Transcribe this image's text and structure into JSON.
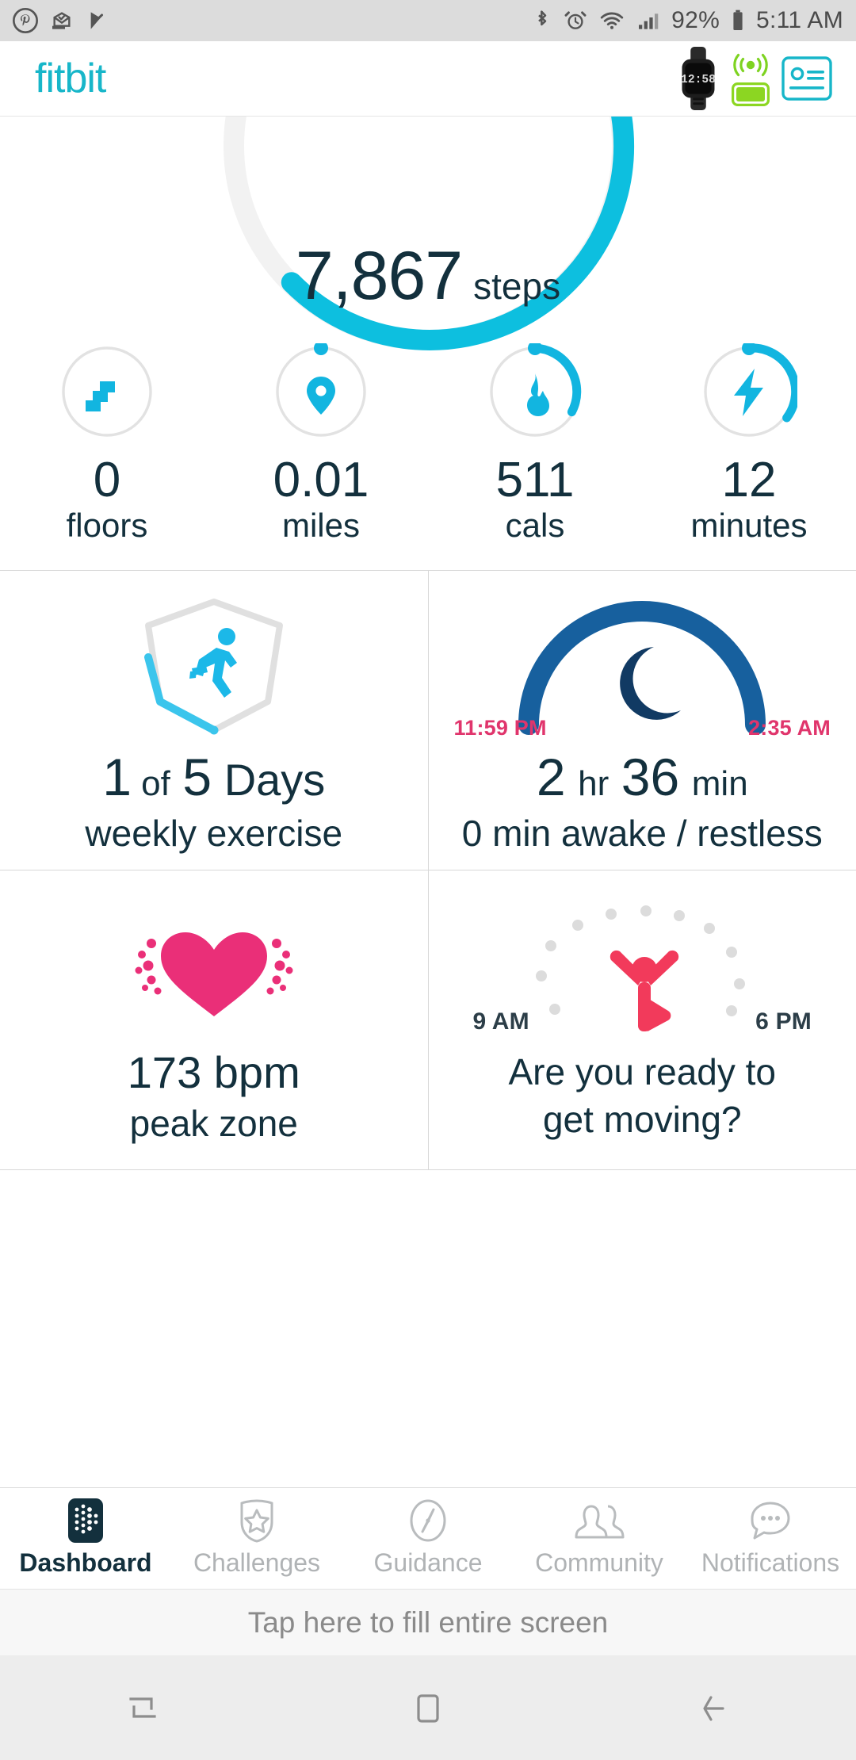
{
  "status_bar": {
    "left_icons": [
      "pinterest-icon",
      "mail-check-icon",
      "play-check-icon"
    ],
    "right_icons": [
      "bluetooth-icon",
      "alarm-icon",
      "wifi-icon",
      "cellular-signal-icon",
      "battery-icon"
    ],
    "battery_percent": "92%",
    "time": "5:11 AM"
  },
  "header": {
    "brand": "fitbit",
    "tracker_time": "12:58",
    "icons": [
      "tracker-icon",
      "sync-icon",
      "tracker-battery-icon",
      "account-card-icon"
    ],
    "colors": {
      "brand": "#17b6c9",
      "sync": "#7ed321",
      "battery": "#8cd622",
      "account": "#17b6c9"
    }
  },
  "steps": {
    "value": "7,867",
    "unit": "steps",
    "goal_progress_pct": 78,
    "ring_color": "#0dbfdf",
    "ring_track_color": "#e2e2e2"
  },
  "stats": [
    {
      "icon": "stairs-icon",
      "value": "0",
      "label": "floors",
      "progress_pct": 0
    },
    {
      "icon": "location-pin-icon",
      "value": "0.01",
      "label": "miles",
      "progress_pct": 1
    },
    {
      "icon": "flame-icon",
      "value": "511",
      "label": "cals",
      "progress_pct": 27
    },
    {
      "icon": "lightning-bolt-icon",
      "value": "12",
      "label": "minutes",
      "progress_pct": 34
    }
  ],
  "cards": {
    "exercise": {
      "icon": "running-person-icon",
      "days_done": "1",
      "of_label": "of",
      "days_goal": "5",
      "days_word": "Days",
      "subtitle": "weekly exercise",
      "progress_pct": 20
    },
    "sleep": {
      "icon": "crescent-moon-icon",
      "start_time": "11:59 PM",
      "end_time": "2:35 AM",
      "hours": "2",
      "hours_unit": "hr",
      "minutes": "36",
      "minutes_unit": "min",
      "subtitle": "0 min awake / restless",
      "arc_color": "#17609e",
      "moon_color": "#113a63",
      "time_color": "#e0356c"
    },
    "heart_rate": {
      "icon": "heart-icon",
      "value": "173 bpm",
      "subtitle": "peak zone",
      "heart_color": "#ea2f78"
    },
    "hourly_activity": {
      "icon": "celebrating-person-icon",
      "start_time": "9 AM",
      "end_time": "6 PM",
      "prompt_line1": "Are you ready to",
      "prompt_line2": "get moving?",
      "figure_color": "#f23a5b",
      "dot_color": "#dcdcdc",
      "dots_total": 10,
      "dots_filled": 0
    }
  },
  "nav": {
    "items": [
      {
        "label": "Dashboard",
        "icon": "fitbit-dots-icon",
        "active": true
      },
      {
        "label": "Challenges",
        "icon": "shield-star-icon",
        "active": false
      },
      {
        "label": "Guidance",
        "icon": "compass-icon",
        "active": false
      },
      {
        "label": "Community",
        "icon": "people-icon",
        "active": false
      },
      {
        "label": "Notifications",
        "icon": "speech-bubble-icon",
        "active": false
      }
    ]
  },
  "fill_screen_bar": {
    "label": "Tap here to fill entire screen"
  },
  "system_nav": {
    "buttons": [
      "recents-icon",
      "home-icon",
      "back-icon"
    ]
  }
}
